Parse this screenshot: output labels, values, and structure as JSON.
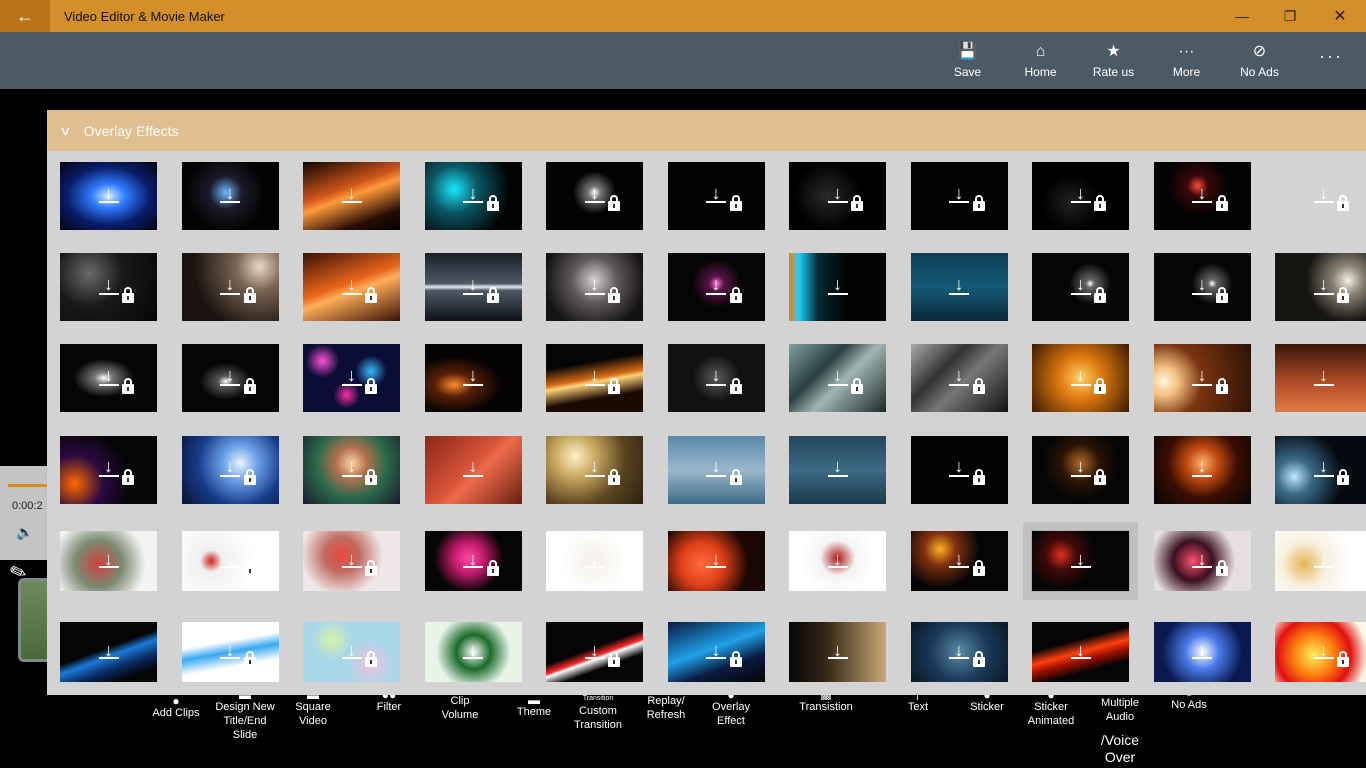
{
  "titlebar": {
    "back_icon": "back-arrow-icon",
    "title": "Video Editor & Movie Maker"
  },
  "commands": [
    {
      "name": "save",
      "label": "Save",
      "icon": "save-icon"
    },
    {
      "name": "home",
      "label": "Home",
      "icon": "home-icon"
    },
    {
      "name": "rate-us",
      "label": "Rate us",
      "icon": "star-icon"
    },
    {
      "name": "more",
      "label": "More",
      "icon": "ellipsis-icon"
    },
    {
      "name": "no-ads",
      "label": "No Ads",
      "icon": "no-ads-icon"
    }
  ],
  "player": {
    "time": "0:00:2"
  },
  "panel": {
    "title": "Overlay Effects"
  },
  "toolbar": [
    {
      "name": "add-clips",
      "label": "Add Clips"
    },
    {
      "name": "design-new-title",
      "label": "Design New Title/End Slide"
    },
    {
      "name": "square-video",
      "label": "Square Video"
    },
    {
      "name": "filter",
      "label": "Filter"
    },
    {
      "name": "clip-volume",
      "label": "Clip Volume"
    },
    {
      "name": "theme",
      "label": "Theme"
    },
    {
      "name": "custom-transition",
      "label": "Custom Transition",
      "sub": "Transition"
    },
    {
      "name": "replay-refresh",
      "label": "Replay/ Refresh"
    },
    {
      "name": "overlay-effect",
      "label": "Overlay Effect"
    },
    {
      "name": "transistion",
      "label": "Transistion"
    },
    {
      "name": "text",
      "label": "Text"
    },
    {
      "name": "sticker",
      "label": "Sticker"
    },
    {
      "name": "sticker-animated",
      "label": "Sticker Animated"
    },
    {
      "name": "multiple-audio",
      "label": "Multiple Audio"
    },
    {
      "name": "voice-over",
      "label": "/Voice Over"
    },
    {
      "name": "no-ads-tool",
      "label": "No Ads"
    }
  ],
  "effects": [
    [
      "radial-gradient(ellipse at 50% 50%, #cfefff 0%, #2f7bff 25%, #0a1d6a 60%, #02040f 100%)",
      false
    ],
    [
      "radial-gradient(circle at 45% 45%, #6fb7ff 0%, #1b1b2b 25%, #030303 60%)",
      false
    ],
    [
      "linear-gradient(160deg, #0b0502 0%, #d0561a 40%, #ff9a3a 50%, #2a0d04 80%, #000 100%)",
      false
    ],
    [
      "radial-gradient(circle at 30% 40%, #19e6ff 0%, #0a5663 30%, #020404 70%)",
      true
    ],
    [
      "radial-gradient(circle at 50% 45%, #ffffff 0%, #777 10%, #020202 35%)",
      true
    ],
    [
      "#020202",
      true
    ],
    [
      "radial-gradient(circle at 40% 50%, #2a2a2a 0%, #000 50%)",
      true
    ],
    [
      "#020202",
      true
    ],
    [
      "radial-gradient(circle at 40% 60%, #222 0%, #000 40%)",
      true
    ],
    [
      "radial-gradient(circle at 45% 35%, #ff4b3a 0%, #3a0808 15%, #020202 45%)",
      true
    ],
    [
      "#d3d3d3",
      true
    ],
    [
      "radial-gradient(circle at 30% 30%, #6a6a6a 0%, #1a1a1a 40%, #050505 100%)",
      true
    ],
    [
      "radial-gradient(circle at 80% 20%, #e9d9c4 0%, #7a6452 25%, #1a130f 70%)",
      true
    ],
    [
      "linear-gradient(160deg, #3a1004 0%, #e9661c 45%, #ffae5a 55%, #3a1004 100%)",
      true
    ],
    [
      "linear-gradient(180deg, #1a1f28 0%, #4f5a66 45%, #e8eef5 50%, #4f5a66 55%, #0e1118 100%)",
      true
    ],
    [
      "radial-gradient(circle at 50% 40%, #d8d0d4 0%, #605a5e 35%, #141214 80%)",
      true
    ],
    [
      "radial-gradient(circle at 50% 45%, #ff77d8 0%, #5a1448 12%, #050505 40%)",
      true
    ],
    [
      "linear-gradient(90deg, #ff7b00 0%, #1cd1ff 10%, #062a33 30%, #020202 60%)",
      false
    ],
    [
      "linear-gradient(180deg, #0d3e55 0%, #145a77 50%, #09283a 100%)",
      false
    ],
    [
      "radial-gradient(circle at 60% 45%, #fff 0%, #666 6%, #050505 30%)",
      true
    ],
    [
      "radial-gradient(circle at 60% 45%, #fff 0%, #666 6%, #050505 30%)",
      true
    ],
    [
      "radial-gradient(circle at 75% 40%, #f3efe5 0%, #8a8274 18%, #171512 50%)",
      true
    ],
    [
      "radial-gradient(ellipse at 45% 50%, #ffffff 0%, #777 12%, #050505 40%)",
      true
    ],
    [
      "radial-gradient(ellipse at 45% 55%, #ffffff 0%, #555 10%, #050505 35%)",
      true
    ],
    [
      "radial-gradient(circle at 20% 25%, #ff4fd8 0%, transparent 18%), radial-gradient(circle at 70% 40%, #39b7ff 0%, transparent 20%), radial-gradient(circle at 45% 75%, #ff2fa8 0%, transparent 18%), #0c0d36",
      true
    ],
    [
      "radial-gradient(ellipse at 30% 60%, #ff8a2a 0%, #5a2008 20%, #040202 50%)",
      false
    ],
    [
      "linear-gradient(170deg, #050505 30%, #d56b15 50%, #ffd27a 55%, #1a0a02 75%)",
      true
    ],
    [
      "radial-gradient(circle at 50% 50%, #5a5a5a 0%, #111 40%)",
      true
    ],
    [
      "linear-gradient(135deg, #7fa0a0 0%, #2b4040 35%, #a0b5b5 55%, #1a2828 100%)",
      true
    ],
    [
      "linear-gradient(135deg, #aaaaaa 0%, #333 35%, #777 55%, #111 100%)",
      true
    ],
    [
      "radial-gradient(circle at 50% 50%, #ffd36a 0%, #e07a10 35%, #3a1a02 100%)",
      true
    ],
    [
      "radial-gradient(circle at 10% 55%, #fff8e0 0%, #f3c080 15%, #7a3410 40%, #2a1206 100%)",
      true
    ],
    [
      "linear-gradient(180deg, #3a1408 0%, #b65028 60%, #e07a44 100%)",
      false
    ],
    [
      "radial-gradient(circle at 15% 70%, #ff6a00 0%, #2a0a40 30%, #050505 60%)",
      true
    ],
    [
      "radial-gradient(circle at 60% 40%, #e8f4ff 0%, #6aa0e8 25%, #173a88 60%, #081430 100%)",
      true
    ],
    [
      "radial-gradient(circle at 50% 40%, #ffd0a0 0%, #b07050 25%, #2a6a4a 55%, #1a1a30 100%)",
      true
    ],
    [
      "linear-gradient(135deg, #8a2818 0%, #d45238 45%, #ee6a4a 55%, #6a1e12 100%)",
      false
    ],
    [
      "radial-gradient(circle at 30% 30%, #fff3c8 0%, #c9a860 25%, #5a4420 60%, #2a2010 100%)",
      true
    ],
    [
      "linear-gradient(180deg, #5a88a8 0%, #9ab8cc 50%, #3f6a88 100%)",
      true
    ],
    [
      "linear-gradient(180deg, #24465c 0%, #3e6a84 50%, #1c3a4e 100%)",
      false
    ],
    [
      "#020202",
      true
    ],
    [
      "radial-gradient(circle at 50% 40%, #b06a28 0%, #2a1406 30%, #050505 60%)",
      true
    ],
    [
      "radial-gradient(circle at 50% 40%, #ffb070 0%, #c04a10 25%, #3a0e02 55%, #050505 100%)",
      false
    ],
    [
      "radial-gradient(circle at 20% 60%, #bfe6ff 0%, #3a6a88 20%, #050a10 55%)",
      true
    ],
    [
      "radial-gradient(circle at 40% 55%, #d04040 0%, #7a8a70 35%, #f4f4f4 70%)",
      false
    ],
    [
      "radial-gradient(circle at 30% 50%, #d02020 0%, #f0f0f0 15%, #ffffff 60%)",
      true
    ],
    [
      "radial-gradient(circle at 40% 40%, #e84a3a 0%, #c06a60 25%, #f0e8e8 60%)",
      true
    ],
    [
      "radial-gradient(circle at 45% 45%, #ff4aa8 0%, #c01a6a 25%, #050505 55%)",
      true
    ],
    [
      "radial-gradient(circle at 50% 50%, #f4f0e8 0%, #ffffff 60%)",
      false
    ],
    [
      "radial-gradient(circle at 35% 55%, #ff6a40 0%, #e04018 30%, #1a0602 65%)",
      false
    ],
    [
      "radial-gradient(circle at 50% 45%, #b01818 0%, #f4f4f4 30%, #ffffff 65%)",
      false
    ],
    [
      "radial-gradient(circle at 30% 30%, #ffb020 0%, #803010 20%, #050505 50%)",
      true
    ],
    [
      "radial-gradient(circle at 30% 40%, #e03020 0%, #400a08 20%, #050505 45%)",
      false
    ],
    [
      "radial-gradient(circle at 40% 50%, #ff5070 0%, #3a1020 30%, #e8e0e0 65%)",
      true
    ],
    [
      "radial-gradient(circle at 30% 55%, #e8b45a 0%, #f8f0e0 30%, #ffffff 65%)",
      false
    ],
    [
      "linear-gradient(160deg, #050505 45%, #1a7ad8 55%, #0a2a60 70%, #050505 85%)",
      false
    ],
    [
      "linear-gradient(170deg, #ffffff 35%, #3aa8f0 50%, #ffffff 70%)",
      true
    ],
    [
      "radial-gradient(circle at 30% 30%, #d8f0a8 0%, transparent 25%), radial-gradient(circle at 70% 70%, #f0c0e0 0%, transparent 30%), #a8d8e8",
      true
    ],
    [
      "radial-gradient(circle at 50% 50%, #ffffff 0%, #1a6a2a 30%, #e8f4e8 65%)",
      false
    ],
    [
      "linear-gradient(160deg, #050505 45%, #ff2a2a 55%, #ffffff 58%, #050505 70%)",
      true
    ],
    [
      "linear-gradient(160deg, #0a1a40 0%, #20a0e8 45%, #0a1a40 70%, #050505 100%)",
      true
    ],
    [
      "linear-gradient(90deg, #050505 0%, #3a2a18 40%, #c8a878 100%)",
      false
    ],
    [
      "radial-gradient(circle at 50% 50%, #5a8aa8 0%, #1a3a58 50%, #081828 100%)",
      true
    ],
    [
      "linear-gradient(165deg, #050505 35%, #ff4010 50%, #a01000 60%, #050505 75%)",
      false
    ],
    [
      "radial-gradient(circle at 50% 50%, #ffffff 0%, #4a7ae8 30%, #0a1a50 70%)",
      false
    ],
    [
      "radial-gradient(circle at 40% 55%, #fff060 0%, #ff8010 30%, #e01010 55%, #fff8e8 80%)",
      true
    ]
  ]
}
